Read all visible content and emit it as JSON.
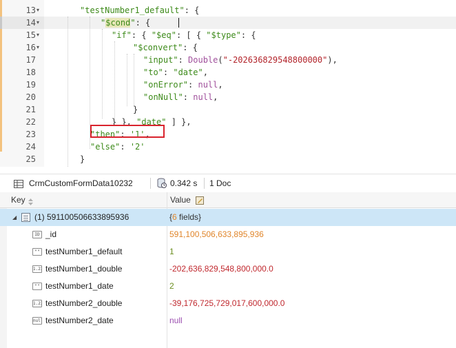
{
  "editor": {
    "line_numbers": [
      "13",
      "14",
      "15",
      "16",
      "17",
      "18",
      "19",
      "20",
      "21",
      "22",
      "23",
      "24",
      "25"
    ],
    "fold_marker": "▾",
    "code": {
      "l13_key": "\"testNumber1_default\"",
      "l13_rest": ": {",
      "l14_q1": "\"",
      "l14_key": "$cond",
      "l14_q2": "\"",
      "l14_rest": ": {",
      "l15_a": "\"if\"",
      "l15_b": ": { ",
      "l15_c": "\"$eq\"",
      "l15_d": ": [ { ",
      "l15_e": "\"$type\"",
      "l15_f": ": {",
      "l16_key": "\"$convert\"",
      "l16_rest": ": {",
      "l17_key": "\"input\"",
      "l17_colon": ": ",
      "l17_fn": "Double",
      "l17_open": "(",
      "l17_arg": "\"-202636829548800000\"",
      "l17_close": "),",
      "l18_key": "\"to\"",
      "l18_colon": ": ",
      "l18_val": "\"date\"",
      "l18_comma": ",",
      "l19_key": "\"onError\"",
      "l19_colon": ": ",
      "l19_val": "null",
      "l19_comma": ",",
      "l20_key": "\"onNull\"",
      "l20_colon": ": ",
      "l20_val": "null",
      "l20_comma": ",",
      "l21": "}",
      "l22_a": "} }, ",
      "l22_b": "\"date\"",
      "l22_c": " ] },",
      "l23_key": "\"then\"",
      "l23_colon": ": ",
      "l23_val": "'1'",
      "l23_comma": ",",
      "l24_key": "\"else\"",
      "l24_colon": ": ",
      "l24_val": "'2'",
      "l25": "}"
    }
  },
  "toolbar": {
    "collection": "CrmCustomFormData10232",
    "time": "0.342 s",
    "doc_count": "1 Doc"
  },
  "table": {
    "headers": {
      "key": "Key",
      "value": "Value"
    },
    "root": {
      "key": "(1) 591100506633895936",
      "value_brace_open": "{",
      "value_count": "6",
      "value_fields": " fields}"
    },
    "rows": [
      {
        "icon_text": "ID",
        "key": "_id",
        "value": "591,100,506,633,895,936"
      },
      {
        "icon_text": "\"\"",
        "key": "testNumber1_default",
        "value": "1"
      },
      {
        "icon_text": "1.23",
        "key": "testNumber1_double",
        "value": "-202,636,829,548,800,000.0"
      },
      {
        "icon_text": "\"\"",
        "key": "testNumber1_date",
        "value": "2"
      },
      {
        "icon_text": "1.23",
        "key": "testNumber2_double",
        "value": "-39,176,725,729,017,600,000.0"
      },
      {
        "icon_text": "null",
        "key": "testNumber2_date",
        "value": "null"
      }
    ]
  },
  "colors": {
    "string": "#3d8a1a",
    "number": "#b2232a",
    "keyword": "#a0509c",
    "id_value": "#e0852a",
    "selection": "#cde6f7",
    "annotation_box": "#d9232d"
  },
  "icons": [
    "fold-arrow-icon",
    "collection-icon",
    "timer-icon",
    "sort-icon",
    "value-edit-icon",
    "expand-arrow-icon",
    "document-icon",
    "field-type-icon"
  ]
}
